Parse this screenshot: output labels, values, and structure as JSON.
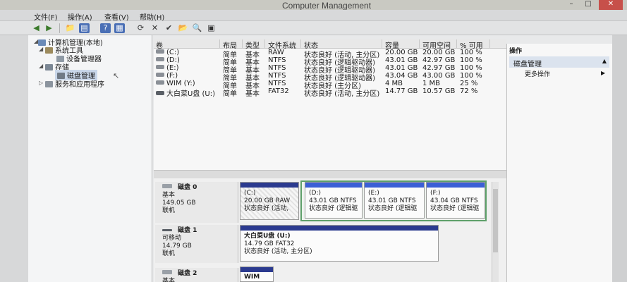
{
  "window": {
    "title": "Computer Management"
  },
  "menu": [
    "文件(F)",
    "操作(A)",
    "查看(V)",
    "帮助(H)"
  ],
  "tree": {
    "root": "计算机管理(本地)",
    "system_tools": "系统工具",
    "device_manager": "设备管理器",
    "storage": "存储",
    "disk_management": "磁盘管理",
    "services_apps": "服务和应用程序"
  },
  "volume_table": {
    "columns": [
      "卷",
      "布局",
      "类型",
      "文件系统",
      "状态",
      "容量",
      "可用空间",
      "% 可用"
    ],
    "rows": [
      [
        "(C:)",
        "简单",
        "基本",
        "RAW",
        "状态良好 (活动, 主分区)",
        "20.00 GB",
        "20.00 GB",
        "100 %"
      ],
      [
        "(D:)",
        "简单",
        "基本",
        "NTFS",
        "状态良好 (逻辑驱动器)",
        "43.01 GB",
        "42.97 GB",
        "100 %"
      ],
      [
        "(E:)",
        "简单",
        "基本",
        "NTFS",
        "状态良好 (逻辑驱动器)",
        "43.01 GB",
        "42.97 GB",
        "100 %"
      ],
      [
        "(F:)",
        "简单",
        "基本",
        "NTFS",
        "状态良好 (逻辑驱动器)",
        "43.04 GB",
        "43.00 GB",
        "100 %"
      ],
      [
        "WIM (Y:)",
        "简单",
        "基本",
        "NTFS",
        "状态良好 (主分区)",
        "4 MB",
        "1 MB",
        "25 %"
      ],
      [
        "大白菜U盘 (U:)",
        "简单",
        "基本",
        "FAT32",
        "状态良好 (活动, 主分区)",
        "14.77 GB",
        "10.57 GB",
        "72 %"
      ]
    ]
  },
  "disks": [
    {
      "name": "磁盘 0",
      "type": "基本",
      "size": "149.05 GB",
      "status": "联机",
      "partitions": [
        {
          "label": "(C:)",
          "size": "20.00 GB RAW",
          "status": "状态良好 (活动,"
        },
        {
          "label": "(D:)",
          "size": "43.01 GB NTFS",
          "status": "状态良好 (逻辑驱"
        },
        {
          "label": "(E:)",
          "size": "43.01 GB NTFS",
          "status": "状态良好 (逻辑驱"
        },
        {
          "label": "(F:)",
          "size": "43.04 GB NTFS",
          "status": "状态良好 (逻辑驱"
        }
      ]
    },
    {
      "name": "磁盘 1",
      "type": "可移动",
      "size": "14.79 GB",
      "status": "联机",
      "partitions": [
        {
          "label": "大白菜U盘 (U:)",
          "size": "14.79 GB FAT32",
          "status": "状态良好 (活动, 主分区)"
        }
      ]
    },
    {
      "name": "磁盘 2",
      "type": "基本",
      "partitions": [
        {
          "label": "WIM"
        }
      ]
    }
  ],
  "actions": {
    "header": "操作",
    "section": "磁盘管理",
    "more": "更多操作"
  },
  "colors": {
    "primary_bar": "#2b3a8f",
    "logical_bar": "#3b5fd6",
    "selection": "#5ea06a"
  }
}
